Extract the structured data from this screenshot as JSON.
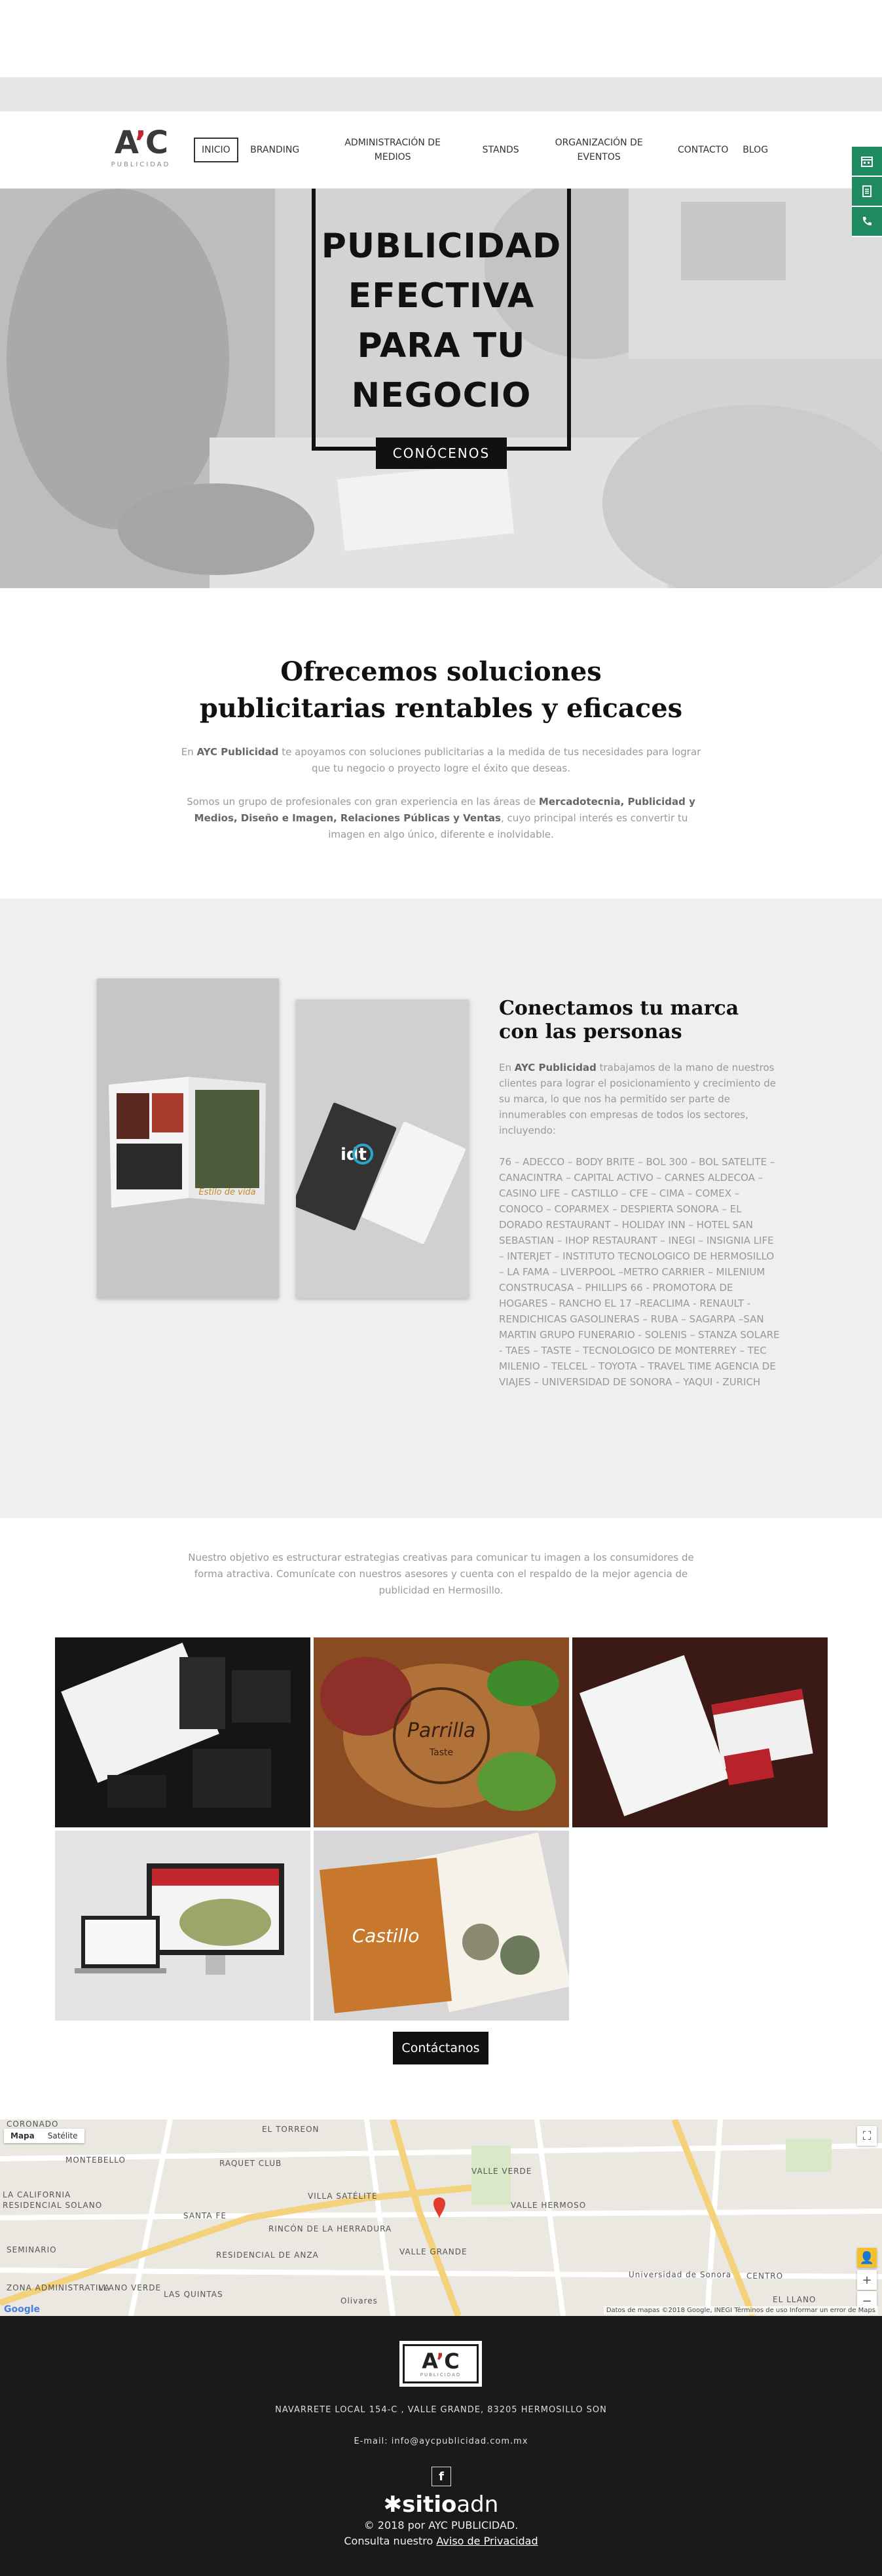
{
  "brand": {
    "logo_text_a": "A",
    "logo_text_c": "C",
    "logo_sub": "PUBLICIDAD",
    "accent_color": "#c4262e",
    "green_color": "#1f8a62"
  },
  "nav": {
    "items": [
      {
        "label": "INICIO",
        "active": true
      },
      {
        "label": "BRANDING"
      },
      {
        "label": "ADMINISTRACIÓN DE MEDIOS"
      },
      {
        "label": "STANDS"
      },
      {
        "label": "ORGANIZACIÓN DE EVENTOS"
      },
      {
        "label": "CONTACTO"
      },
      {
        "label": "BLOG"
      }
    ]
  },
  "side_icons": [
    "calendar-icon",
    "document-icon",
    "phone-icon"
  ],
  "hero": {
    "title": "PUBLICIDAD EFECTIVA PARA TU NEGOCIO",
    "cta": "CONÓCENOS"
  },
  "intro": {
    "heading": "Ofrecemos soluciones publicitarias rentables y eficaces",
    "p1_pre": "En ",
    "p1_strong": "AYC Publicidad",
    "p1_post": " te apoyamos con soluciones publicitarias a la medida de tus necesidades para lograr que tu negocio o proyecto logre el éxito que deseas.",
    "p2_pre": "Somos un grupo de profesionales con gran experiencia en las áreas de ",
    "p2_strong": "Mercadotecnia, Publicidad y Medios, Diseño e Imagen, Relaciones Públicas y Ventas",
    "p2_post": ", cuyo principal interés es convertir tu imagen en algo único, diferente e inolvidable."
  },
  "connect": {
    "heading": "Conectamos tu marca con las personas",
    "p1_pre": "En ",
    "p1_strong": "AYC Publicidad",
    "p1_post": " trabajamos de la mano de nuestros clientes para lograr el posicionamiento y crecimiento de su marca, lo que nos ha permitido ser parte de innumerables con empresas de todos los sectores, incluyendo:",
    "clients": "76 – ADECCO – BODY BRITE – BOL 300 – BOL SATELITE – CANACINTRA – CAPITAL ACTIVO – CARNES ALDECOA – CASINO LIFE – CASTILLO – CFE – CIMA – COMEX – CONOCO – COPARMEX – DESPIERTA SONORA – EL DORADO RESTAURANT – HOLIDAY INN – HOTEL SAN SEBASTIAN – IHOP RESTAURANT – INEGI – INSIGNIA LIFE – INTERJET – INSTITUTO TECNOLOGICO DE HERMOSILLO – LA FAMA – LIVERPOOL –METRO CARRIER – MILENIUM CONSTRUCASA – PHILLIPS 66 - PROMOTORA DE HOGARES – RANCHO EL 17 –REACLIMA - RENAULT - RENDICHICAS GASOLINERAS – RUBA – SAGARPA –SAN MARTIN GRUPO FUNERARIO - SOLENIS – STANZA SOLARE - TAES – TASTE – TECNOLOGICO DE MONTERREY – TEC MILENIO – TELCEL – TOYOTA – TRAVEL TIME AGENCIA DE VIAJES – UNIVERSIDAD DE SONORA – YAQUI - ZURICH",
    "magazine_caption": "Estilo de vida",
    "card_logo": "idt"
  },
  "objective": {
    "text": "Nuestro objetivo es estructurar estrategias creativas para comunicar tu imagen a los consumidores de forma atractiva. Comunícate con nuestros asesores y cuenta con el respaldo de la mejor agencia de publicidad en Hermosillo.",
    "cta": "Contáctanos",
    "tiles": [
      {
        "name": "stationery-black"
      },
      {
        "name": "parrilla-taste",
        "label": "Parrilla",
        "sub": "Taste"
      },
      {
        "name": "red-letterhead"
      },
      {
        "name": "web-devices"
      },
      {
        "name": "castillo-brochure",
        "label": "Castillo"
      }
    ]
  },
  "map": {
    "tab_map": "Mapa",
    "tab_sat": "Satélite",
    "google": "Google",
    "footer": "Datos de mapas ©2018 Google, INEGI   Términos de uso   Informar un error de Maps",
    "labels": [
      "CORONADO",
      "EL TORREON",
      "MONTEBELLO",
      "RAQUET CLUB",
      "VALLE VERDE",
      "LA CALIFORNIA",
      "RESIDENCIAL SOLANO",
      "SANTA FE",
      "VILLA SATÉLITE",
      "VALLE HERMOSO",
      "SEMINARIO",
      "VALLE GRANDE",
      "LAS QUINTAS",
      "RESIDENCIAL DE ANZA",
      "RINCÓN DE LA HERRADURA",
      "LLANO VERDE",
      "CENTRO",
      "Universidad de Sonora",
      "Olivares",
      "ZONA ADMINISTRATIVA",
      "EL LLANO"
    ]
  },
  "footer": {
    "logo_a": "A",
    "logo_c": "C",
    "logo_sub": "PUBLICIDAD",
    "address": "NAVARRETE LOCAL 154-C , VALLE GRANDE, 83205 HERMOSILLO SON",
    "email": "E-mail: info@aycpublicidad.com.mx",
    "fb": "f",
    "brand_a": "sitio",
    "brand_b": "adn",
    "copyright": "© 2018 por AYC PUBLICIDAD.",
    "privacy_pre": "Consulta nuestro ",
    "privacy_link": "Aviso de Privacidad"
  }
}
